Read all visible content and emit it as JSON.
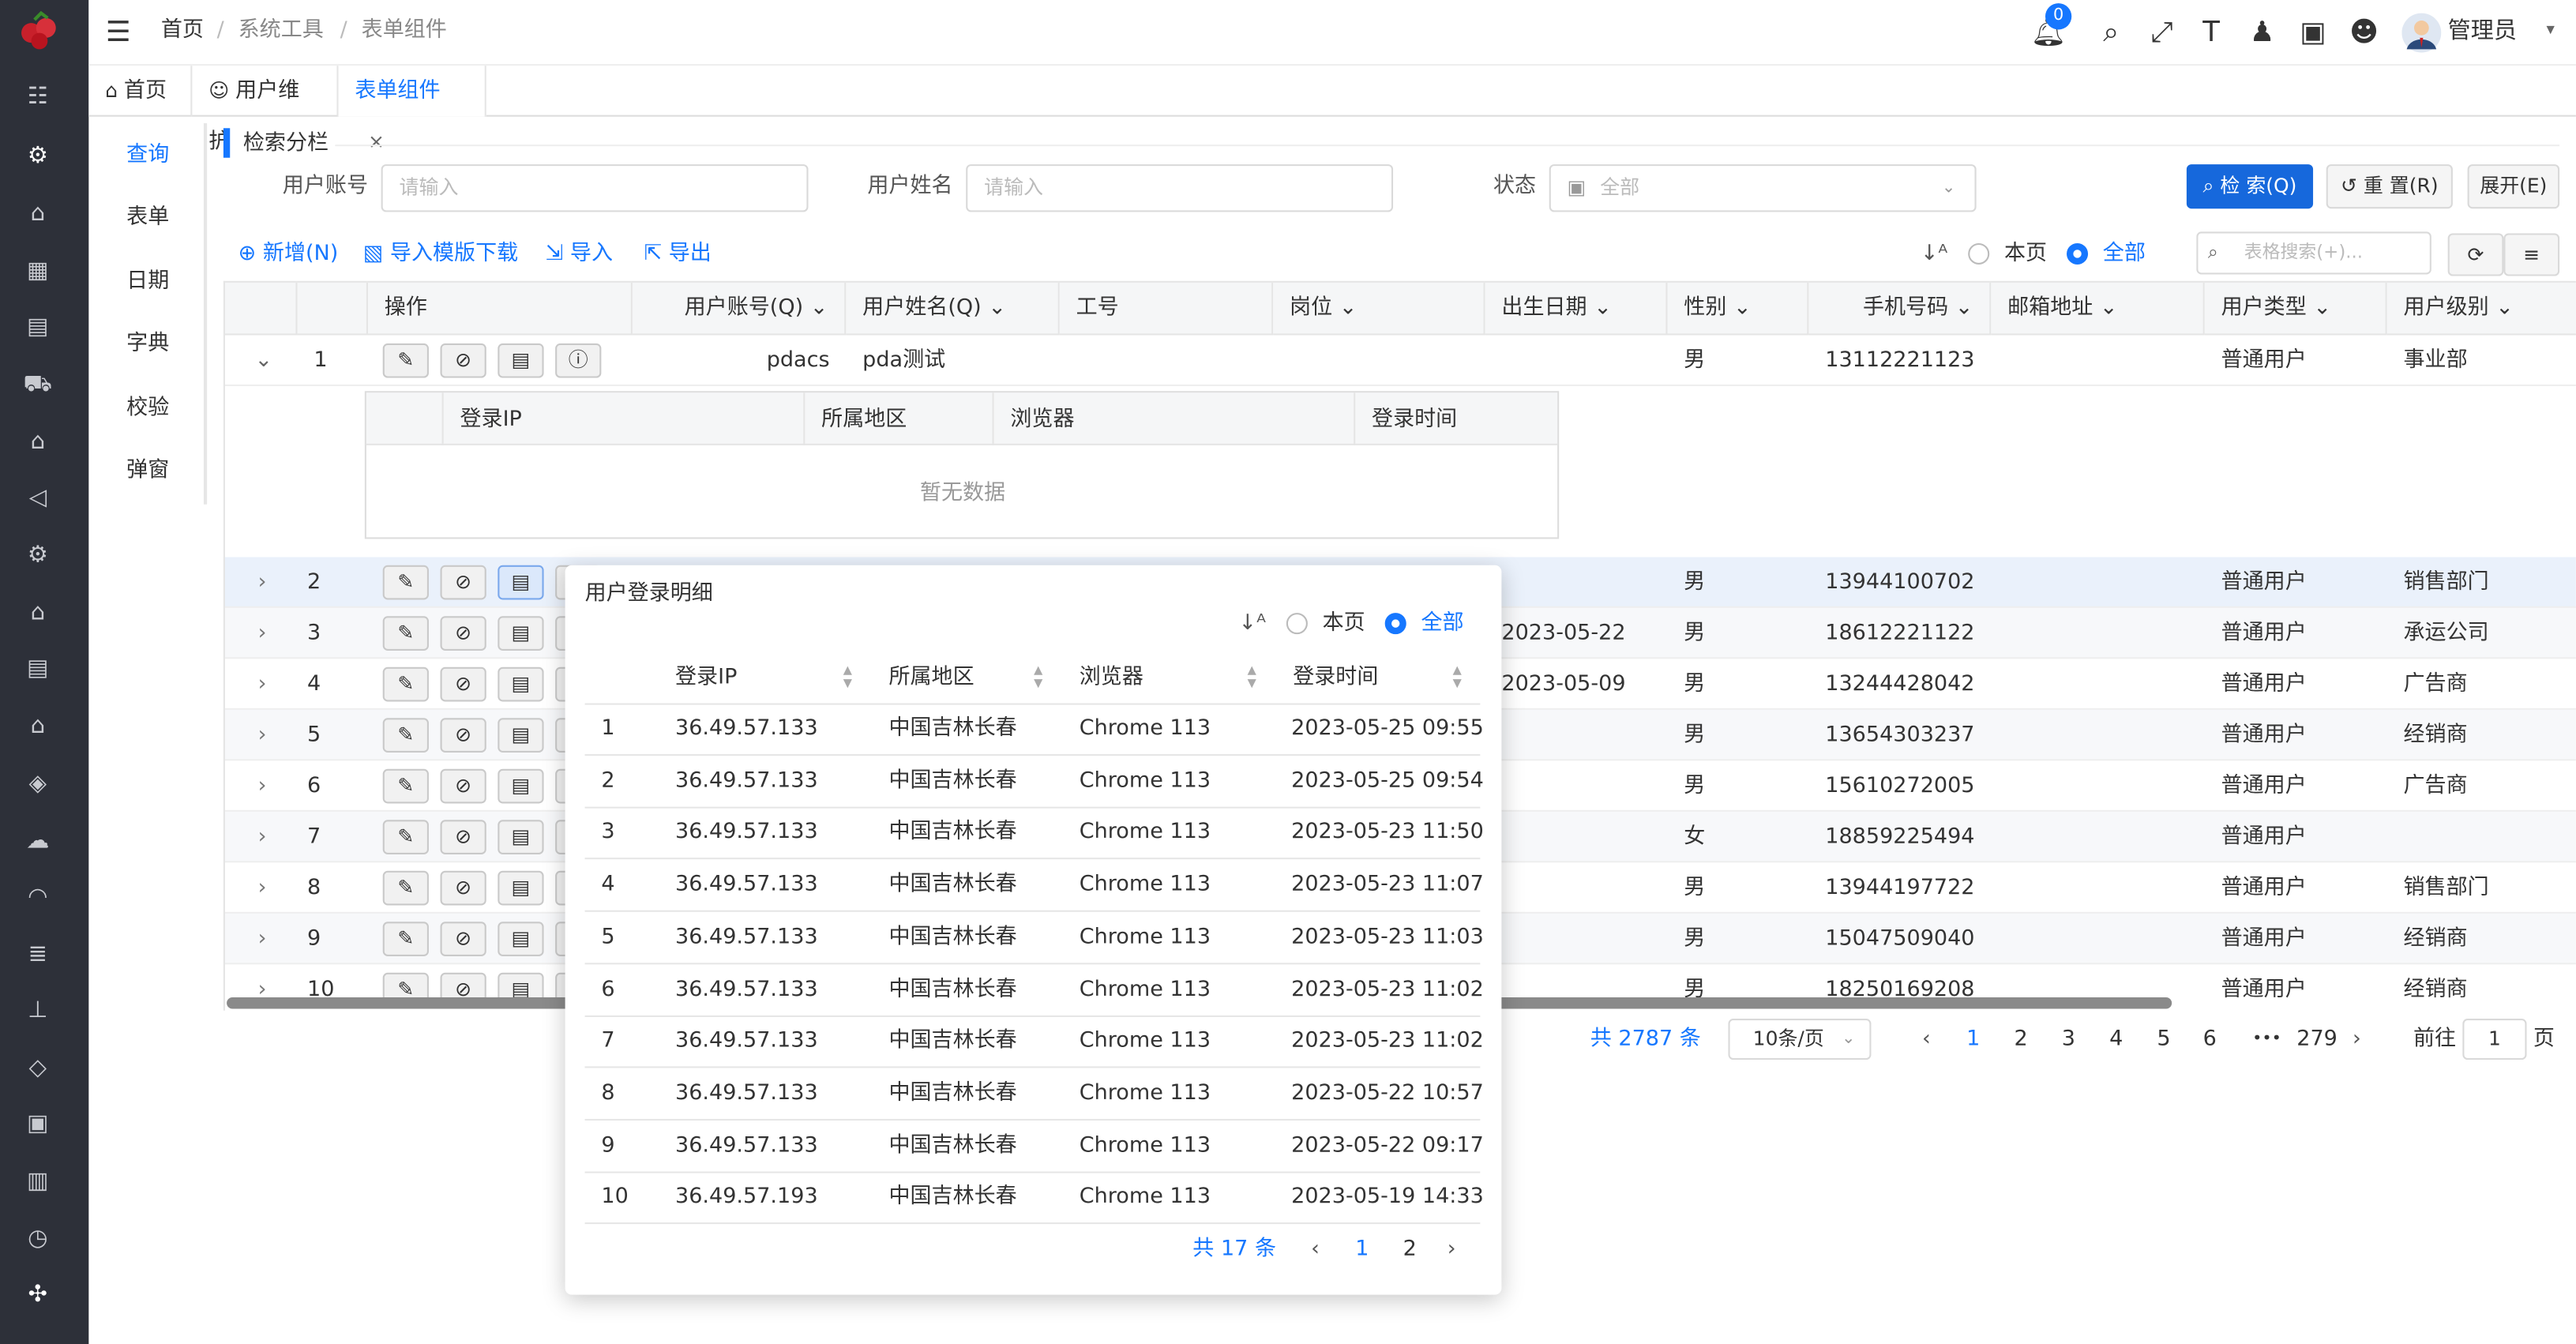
{
  "breadcrumb": [
    "首页",
    "系统工具",
    "表单组件"
  ],
  "header": {
    "notification_count": "0",
    "user_name": "管理员"
  },
  "tabs": [
    {
      "label": "首页"
    },
    {
      "label": "用户维护"
    },
    {
      "label": "表单组件",
      "close": "×"
    }
  ],
  "submenu": [
    "查询",
    "表单",
    "日期",
    "字典",
    "校验",
    "弹窗"
  ],
  "search": {
    "section_title": "检索分栏",
    "account_label": "用户账号",
    "account_placeholder": "请输入",
    "name_label": "用户姓名",
    "name_placeholder": "请输入",
    "status_label": "状态",
    "status_value": "全部",
    "search_btn": "检 索(Q)",
    "reset_btn": "重 置(R)",
    "expand_btn": "展开(E)"
  },
  "toolbar": {
    "add": "新增(N)",
    "template": "导入模版下载",
    "import": "导入",
    "export": "导出",
    "scope_page": "本页",
    "scope_all": "全部",
    "table_search_placeholder": "表格搜索(+)..."
  },
  "columns": [
    "操作",
    "用户账号(Q)",
    "用户姓名(Q)",
    "工号",
    "岗位",
    "出生日期",
    "性别",
    "手机号码",
    "邮箱地址",
    "用户类型",
    "用户级别"
  ],
  "rows": [
    {
      "idx": "1",
      "account": "pdacs",
      "name": "pda测试",
      "birth": "",
      "gender": "男",
      "phone": "13112221123",
      "type": "普通用户",
      "level": "事业部"
    },
    {
      "idx": "2",
      "account": "",
      "name": "",
      "birth": "",
      "gender": "男",
      "phone": "13944100702",
      "type": "普通用户",
      "level": "销售部门"
    },
    {
      "idx": "3",
      "account": "",
      "name": "",
      "birth": "2023-05-22",
      "gender": "男",
      "phone": "18612221122",
      "type": "普通用户",
      "level": "承运公司"
    },
    {
      "idx": "4",
      "account": "",
      "name": "",
      "birth": "2023-05-09",
      "gender": "男",
      "phone": "13244428042",
      "type": "普通用户",
      "level": "广告商"
    },
    {
      "idx": "5",
      "account": "",
      "name": "",
      "birth": "",
      "gender": "男",
      "phone": "13654303237",
      "type": "普通用户",
      "level": "经销商"
    },
    {
      "idx": "6",
      "account": "",
      "name": "",
      "birth": "",
      "gender": "男",
      "phone": "15610272005",
      "type": "普通用户",
      "level": "广告商"
    },
    {
      "idx": "7",
      "account": "",
      "name": "",
      "birth": "",
      "gender": "女",
      "phone": "18859225494",
      "type": "普通用户",
      "level": ""
    },
    {
      "idx": "8",
      "account": "",
      "name": "",
      "birth": "",
      "gender": "男",
      "phone": "13944197722",
      "type": "普通用户",
      "level": "销售部门"
    },
    {
      "idx": "9",
      "account": "",
      "name": "",
      "birth": "",
      "gender": "男",
      "phone": "15047509040",
      "type": "普通用户",
      "level": "经销商"
    },
    {
      "idx": "10",
      "account": "",
      "name": "",
      "birth": "",
      "gender": "男",
      "phone": "18250169208",
      "type": "普通用户",
      "level": "经销商"
    }
  ],
  "subtable": {
    "columns": [
      "登录IP",
      "所属地区",
      "浏览器",
      "登录时间"
    ],
    "empty": "暂无数据"
  },
  "pager": {
    "total": "共 2787 条",
    "page_size": "10条/页",
    "pages": [
      "1",
      "2",
      "3",
      "4",
      "5",
      "6",
      "•••",
      "279"
    ],
    "goto_label": "前往",
    "goto_value": "1",
    "goto_suffix": "页"
  },
  "popup": {
    "title": "用户登录明细",
    "scope_page": "本页",
    "scope_all": "全部",
    "columns": [
      "登录IP",
      "所属地区",
      "浏览器",
      "登录时间"
    ],
    "rows": [
      {
        "i": "1",
        "ip": "36.49.57.133",
        "region": "中国吉林长春",
        "browser": "Chrome 113",
        "time": "2023-05-25 09:55"
      },
      {
        "i": "2",
        "ip": "36.49.57.133",
        "region": "中国吉林长春",
        "browser": "Chrome 113",
        "time": "2023-05-25 09:54"
      },
      {
        "i": "3",
        "ip": "36.49.57.133",
        "region": "中国吉林长春",
        "browser": "Chrome 113",
        "time": "2023-05-23 11:50"
      },
      {
        "i": "4",
        "ip": "36.49.57.133",
        "region": "中国吉林长春",
        "browser": "Chrome 113",
        "time": "2023-05-23 11:07"
      },
      {
        "i": "5",
        "ip": "36.49.57.133",
        "region": "中国吉林长春",
        "browser": "Chrome 113",
        "time": "2023-05-23 11:03"
      },
      {
        "i": "6",
        "ip": "36.49.57.133",
        "region": "中国吉林长春",
        "browser": "Chrome 113",
        "time": "2023-05-23 11:02"
      },
      {
        "i": "7",
        "ip": "36.49.57.133",
        "region": "中国吉林长春",
        "browser": "Chrome 113",
        "time": "2023-05-23 11:02"
      },
      {
        "i": "8",
        "ip": "36.49.57.133",
        "region": "中国吉林长春",
        "browser": "Chrome 113",
        "time": "2023-05-22 10:57"
      },
      {
        "i": "9",
        "ip": "36.49.57.133",
        "region": "中国吉林长春",
        "browser": "Chrome 113",
        "time": "2023-05-22 09:17"
      },
      {
        "i": "10",
        "ip": "36.49.57.193",
        "region": "中国吉林长春",
        "browser": "Chrome 113",
        "time": "2023-05-19 14:33"
      }
    ],
    "total": "共 17 条",
    "pages": [
      "1",
      "2"
    ]
  },
  "colors": {
    "accent": "#1677ff",
    "sidebar_bg": "#2d3039",
    "primary_button": "#1668dc"
  }
}
